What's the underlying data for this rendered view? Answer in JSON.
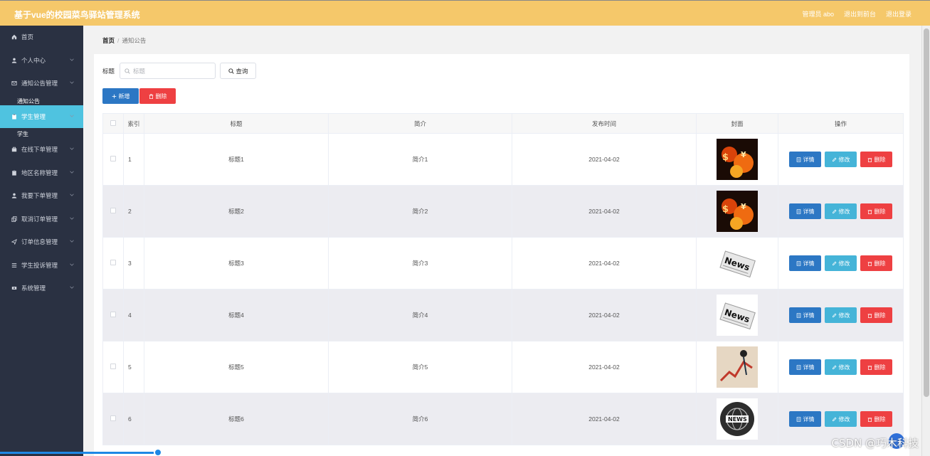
{
  "header": {
    "app_title": "基于vue的校园菜鸟驿站管理系统",
    "user_label": "管理员 abo",
    "exit_home": "退出到前台",
    "logout": "退出登录"
  },
  "sidebar": {
    "items": [
      {
        "label": "首页",
        "icon": "home-icon"
      },
      {
        "label": "个人中心",
        "icon": "user-icon"
      },
      {
        "label": "通知公告管理",
        "icon": "mail-icon",
        "sub": "通知公告"
      },
      {
        "label": "学生管理",
        "icon": "clipboard-icon",
        "sub": "学生",
        "active": true
      },
      {
        "label": "在线下单管理",
        "icon": "bag-icon"
      },
      {
        "label": "地区名称管理",
        "icon": "clipboard-icon"
      },
      {
        "label": "我要下单管理",
        "icon": "user-icon"
      },
      {
        "label": "取消订单管理",
        "icon": "copy-icon"
      },
      {
        "label": "订单信息管理",
        "icon": "send-icon"
      },
      {
        "label": "学生投诉管理",
        "icon": "list-icon"
      },
      {
        "label": "系统管理",
        "icon": "ticket-icon"
      }
    ]
  },
  "breadcrumb": {
    "home": "首页",
    "sep": "/",
    "current": "通知公告"
  },
  "search": {
    "label": "标题",
    "placeholder": "标题",
    "button": "查询"
  },
  "actions": {
    "add": "新增",
    "delete": "删除"
  },
  "table": {
    "columns": [
      "索引",
      "标题",
      "简介",
      "发布时间",
      "封面",
      "操作"
    ],
    "row_buttons": {
      "detail": "详情",
      "edit": "修改",
      "delete": "删除"
    },
    "rows": [
      {
        "index": "1",
        "title": "标题1",
        "intro": "简介1",
        "date": "2021-04-02",
        "cover": "fire"
      },
      {
        "index": "2",
        "title": "标题2",
        "intro": "简介2",
        "date": "2021-04-02",
        "cover": "fire"
      },
      {
        "index": "3",
        "title": "标题3",
        "intro": "简介3",
        "date": "2021-04-02",
        "cover": "news-paper"
      },
      {
        "index": "4",
        "title": "标题4",
        "intro": "简介4",
        "date": "2021-04-02",
        "cover": "news-paper"
      },
      {
        "index": "5",
        "title": "标题5",
        "intro": "简介5",
        "date": "2021-04-02",
        "cover": "chart-arrow"
      },
      {
        "index": "6",
        "title": "标题6",
        "intro": "简介6",
        "date": "2021-04-02",
        "cover": "news-globe"
      }
    ]
  },
  "watermark": "CSDN @巧木科技",
  "colors": {
    "topbar": "#f5c86a",
    "sidebar": "#2a3142",
    "active": "#4fc3e0",
    "primary": "#2c77c4",
    "danger": "#ee4042",
    "info": "#45b4d8"
  }
}
